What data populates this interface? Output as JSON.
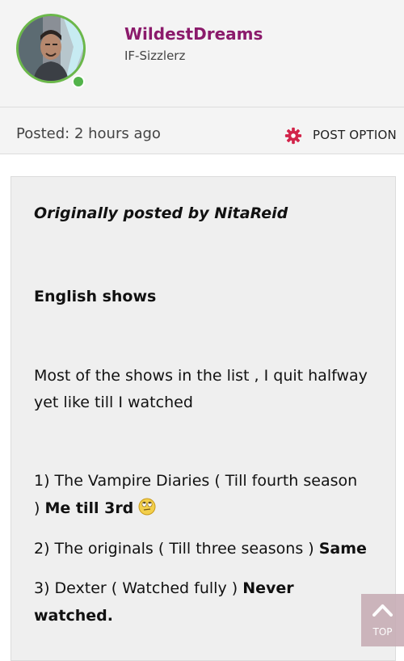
{
  "user": {
    "name": "WildestDreams",
    "group": "IF-Sizzlerz"
  },
  "meta": {
    "posted": "Posted: 2 hours ago",
    "post_option": "POST OPTION"
  },
  "quote": {
    "attribution": "Originally posted by NitaReid",
    "heading": "English shows",
    "intro_line1": "Most of the shows in the list , I quit halfway",
    "intro_line2": "yet like till I watched",
    "item1_line1": "1) The Vampire Diaries ( Till fourth season",
    "item1_line2_plain": ") ",
    "item1_reply": "Me till 3rd",
    "item2_plain": "2) The originals ( Till three seasons ) ",
    "item2_reply": "Same",
    "item3_plain": "3) Dexter ( Watched fully )  ",
    "item3_reply_part1": "Never",
    "item3_reply_part2": "watched."
  },
  "top_button": {
    "label": "TOP"
  },
  "colors": {
    "username": "#8b1a6b",
    "accent": "#d2244a",
    "online": "#52b34a"
  },
  "icons": {
    "settings": "gear-icon",
    "emoji": "rolling-eyes-emoji",
    "top": "chevron-up-icon"
  }
}
